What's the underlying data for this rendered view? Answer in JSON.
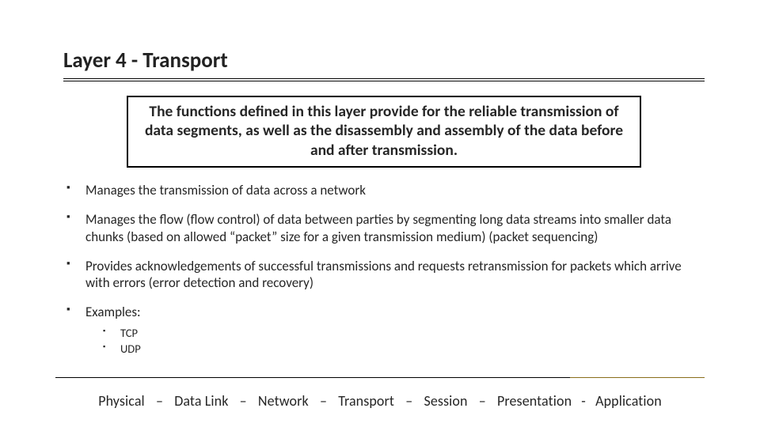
{
  "title": "Layer 4 - Transport",
  "summary": "The functions defined in this layer provide for the reliable transmission of data segments, as well as the disassembly and assembly of the data before and after transmission.",
  "bullets": {
    "b0": "Manages the transmission of data across a network",
    "b1": "Manages the flow (flow control) of data between parties by segmenting long data streams into smaller data chunks (based on allowed “packet” size for a given transmission medium) (packet sequencing)",
    "b2": "Provides acknowledgements of successful transmissions and requests retransmission for packets which arrive with errors (error detection and recovery)",
    "b3": "Examples:",
    "sub": {
      "s0": "TCP",
      "s1": "UDP"
    }
  },
  "layers": {
    "l0": "Physical",
    "l1": "Data Link",
    "l2": "Network",
    "l3": "Transport",
    "l4": "Session",
    "l5": "Presentation",
    "l6": "Application"
  },
  "sep_long": "–",
  "sep_short": "-"
}
